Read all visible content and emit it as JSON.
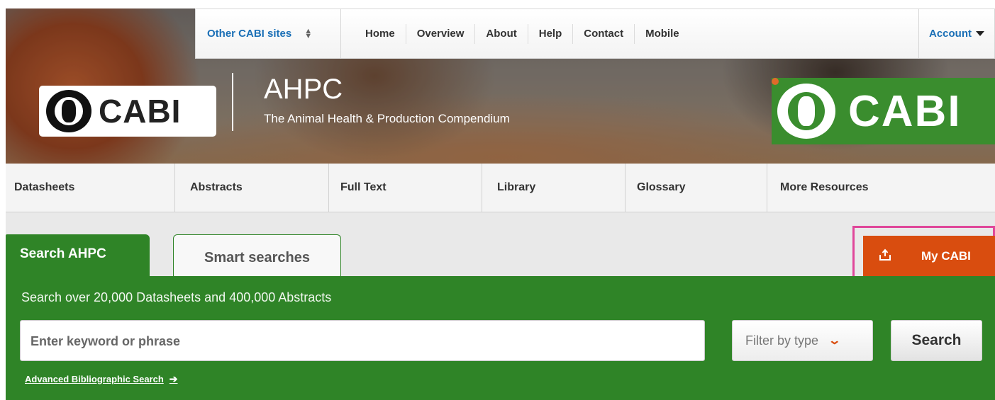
{
  "topnav": {
    "sites_label": "Other CABI sites",
    "links": [
      "Home",
      "Overview",
      "About",
      "Help",
      "Contact",
      "Mobile"
    ],
    "account_label": "Account"
  },
  "header": {
    "logo_text": "CABI",
    "title": "AHPC",
    "subtitle": "The Animal Health & Production Compendium",
    "logo_right_text": "CABI"
  },
  "sectionnav": {
    "items": [
      "Datasheets",
      "Abstracts",
      "Full Text",
      "Library",
      "Glossary",
      "More Resources"
    ]
  },
  "tabs": {
    "active": "Search AHPC",
    "inactive": "Smart searches"
  },
  "mycabi": {
    "label": "My CABI",
    "icon": "upload-tray-icon"
  },
  "search": {
    "description": "Search over 20,000 Datasheets and 400,000 Abstracts",
    "placeholder": "Enter keyword or phrase",
    "value": "",
    "filter_label": "Filter by type",
    "button_label": "Search",
    "advanced_link": "Advanced Bibliographic Search"
  },
  "colors": {
    "brand_green": "#2f8427",
    "accent_orange": "#d94d0f",
    "link_blue": "#1a6fb6",
    "highlight_pink": "#e0479a"
  }
}
